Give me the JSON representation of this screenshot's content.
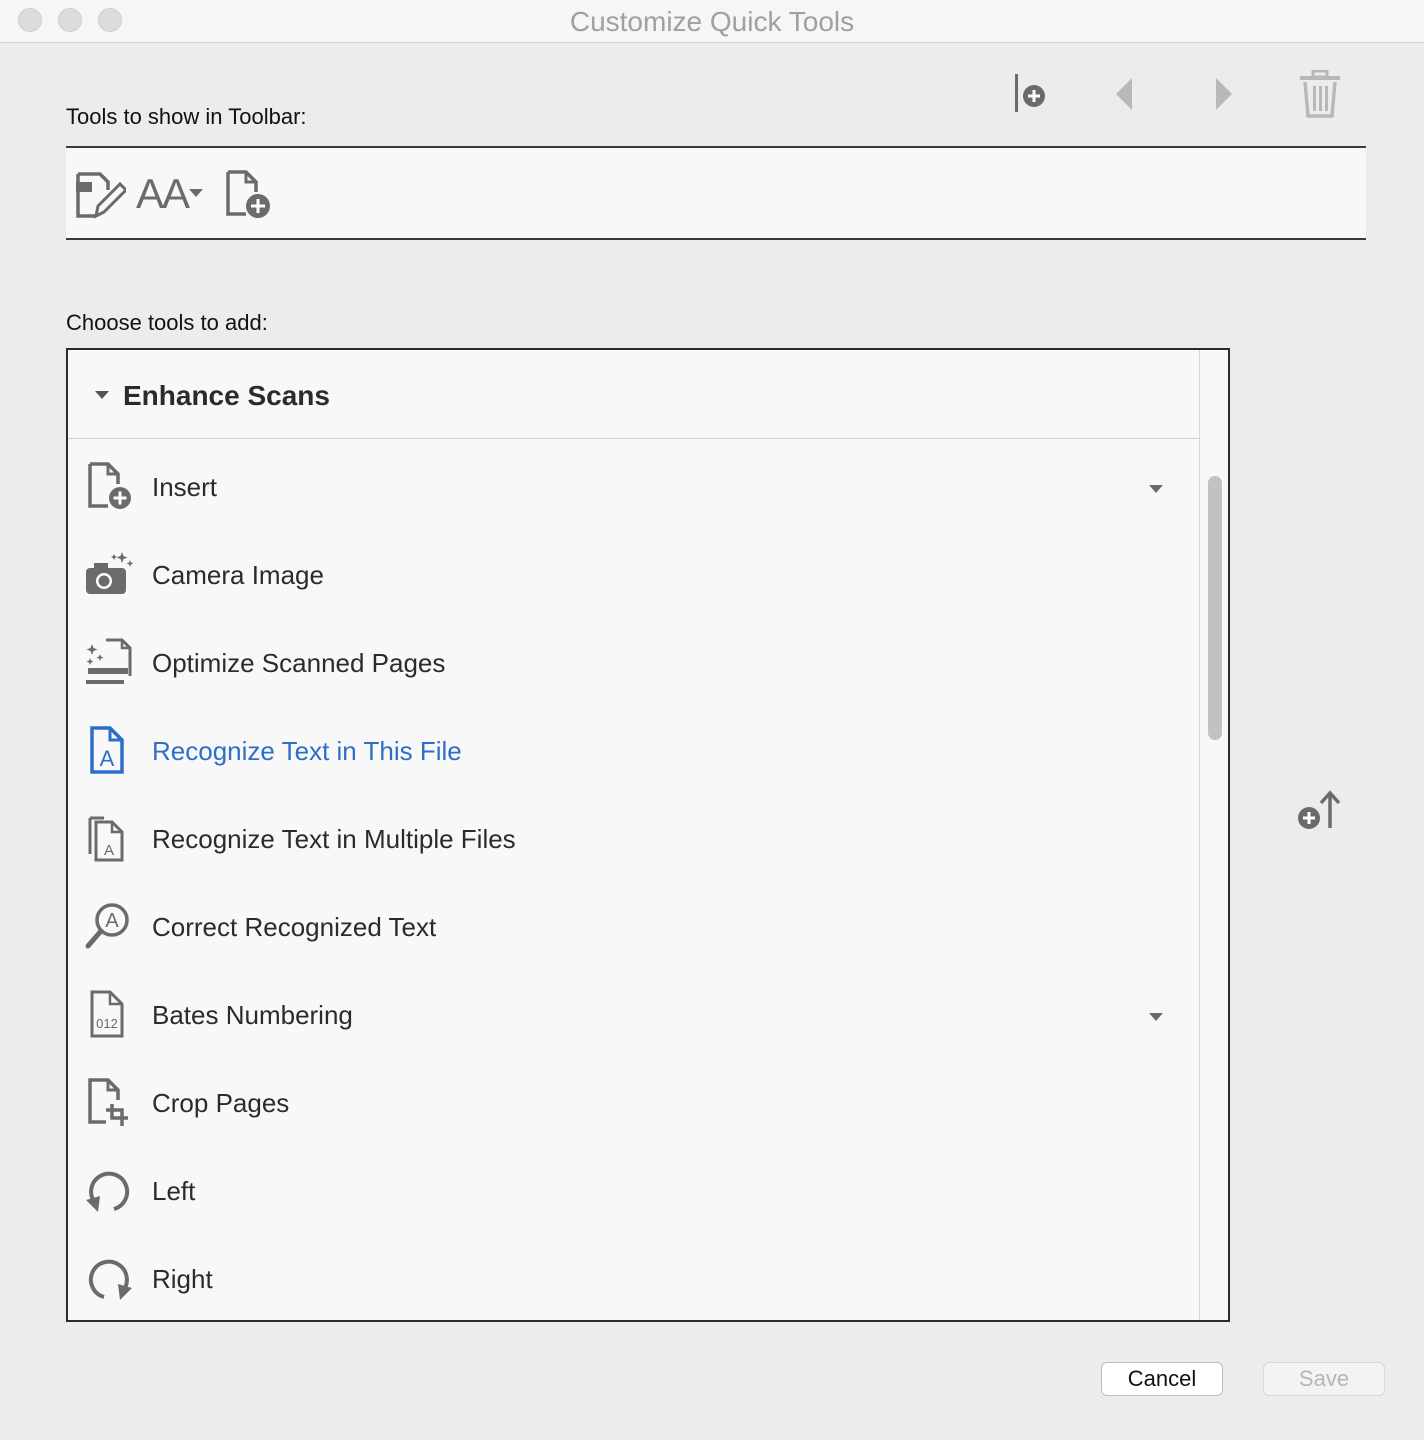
{
  "window": {
    "title": "Customize Quick Tools"
  },
  "toolbar_section": {
    "label": "Tools to show in Toolbar:",
    "actions": [
      "insert-separator-icon",
      "move-left-icon",
      "move-right-icon",
      "trash-icon"
    ],
    "current_tools": [
      {
        "icon": "edit-pdf-icon"
      },
      {
        "icon": "text-size-icon",
        "text": "AA"
      },
      {
        "icon": "insert-pages-icon"
      }
    ]
  },
  "choose_section": {
    "label": "Choose tools to add:",
    "group": {
      "title": "Enhance Scans",
      "items": [
        {
          "label": "Insert",
          "icon": "insert-pages-icon",
          "has_dropdown": true
        },
        {
          "label": "Camera Image",
          "icon": "camera-icon"
        },
        {
          "label": "Optimize Scanned Pages",
          "icon": "optimize-scan-icon"
        },
        {
          "label": "Recognize Text in This File",
          "icon": "recognize-text-icon",
          "selected": true
        },
        {
          "label": "Recognize Text in Multiple Files",
          "icon": "recognize-multiple-icon"
        },
        {
          "label": "Correct Recognized Text",
          "icon": "correct-text-icon"
        },
        {
          "label": "Bates Numbering",
          "icon": "bates-numbering-icon",
          "has_dropdown": true,
          "icon_text": "012"
        },
        {
          "label": "Crop Pages",
          "icon": "crop-icon"
        },
        {
          "label": "Left",
          "icon": "rotate-left-icon"
        },
        {
          "label": "Right",
          "icon": "rotate-right-icon"
        }
      ]
    }
  },
  "buttons": {
    "cancel": "Cancel",
    "save": "Save"
  },
  "colors": {
    "selected_text": "#2d6ec9",
    "icon_gray": "#6b6b6b",
    "icon_blue": "#2d6ec9"
  }
}
